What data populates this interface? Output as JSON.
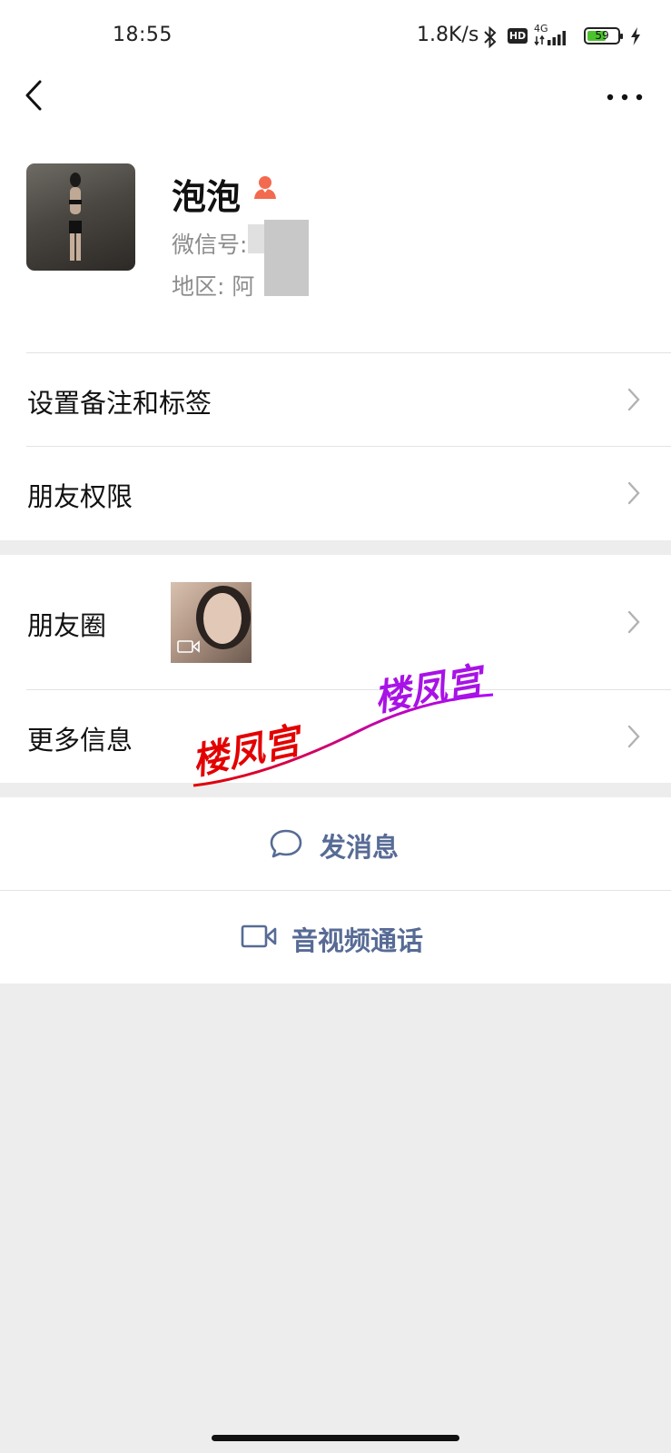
{
  "status_bar": {
    "time": "18:55",
    "network_speed": "1.8K/s",
    "hd_badge": "HD",
    "network_type": "4G",
    "battery_level": "59",
    "icons": [
      "bluetooth-icon",
      "hd-icon",
      "signal-icon",
      "battery-icon",
      "charging-icon"
    ]
  },
  "nav": {
    "back_icon": "chevron-left-icon",
    "more_icon": "more-dots-icon"
  },
  "profile": {
    "name": "泡泡",
    "gender_icon": "female-icon",
    "wechat_id_label": "微信号:",
    "wechat_id_value": "",
    "region_label": "地区:",
    "region_value": "阿"
  },
  "menu": {
    "set_remark": "设置备注和标签",
    "friend_permission": "朋友权限",
    "moments": "朋友圈",
    "more_info": "更多信息"
  },
  "watermark": {
    "text_1": "楼凤宫",
    "text_2": "楼凤宫"
  },
  "actions": {
    "send_message": "发消息",
    "video_call": "音视频通话"
  },
  "colors": {
    "link_blue": "#576b95",
    "background": "#ededed",
    "female_icon": "#f36a4f"
  }
}
